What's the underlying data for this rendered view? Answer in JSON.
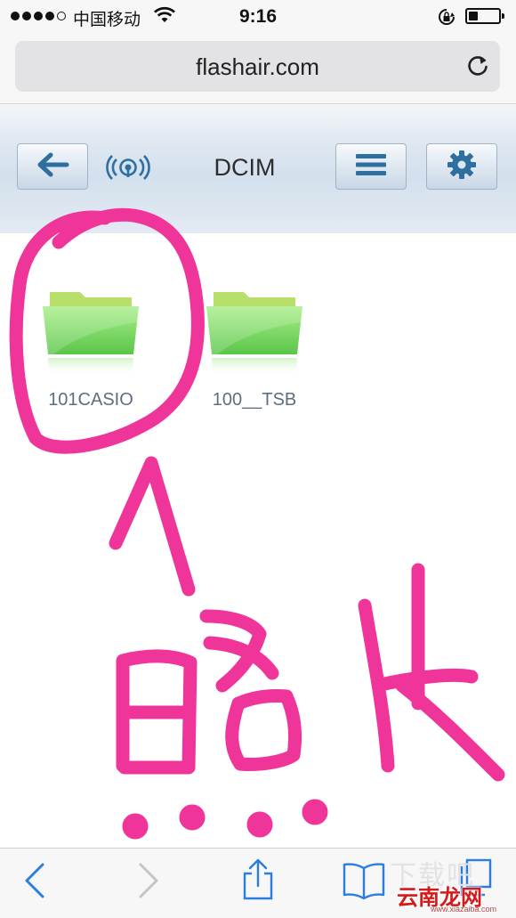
{
  "status_bar": {
    "carrier": "中国移动",
    "time": "9:16",
    "signal_bars_filled": 4,
    "signal_bars_total": 5,
    "battery_level": 0.3
  },
  "browser": {
    "url": "flashair.com"
  },
  "app_header": {
    "title": "DCIM",
    "back_icon": "left-arrow-icon",
    "logo_icon": "flashair-wireless-logo-icon",
    "menu_icon": "hamburger-menu-icon",
    "settings_icon": "gear-icon",
    "accent_color": "#2f6f9f"
  },
  "folders": [
    {
      "name": "101CASIO",
      "icon": "folder-icon",
      "color": "#7ed957"
    },
    {
      "name": "100__TSB",
      "icon": "folder-icon",
      "color": "#7ed957"
    }
  ],
  "annotation": {
    "text": "照片",
    "color": "#f0359a",
    "shapes": [
      "circle-around-101CASIO",
      "arrow-up"
    ]
  },
  "toolbar": {
    "icons": [
      "back-chevron-icon",
      "forward-chevron-icon",
      "share-icon",
      "bookmarks-icon",
      "tabs-icon"
    ]
  },
  "watermark": {
    "main": "云南龙网",
    "sub": "www.xiazaiba.com",
    "background": "下载吧"
  }
}
